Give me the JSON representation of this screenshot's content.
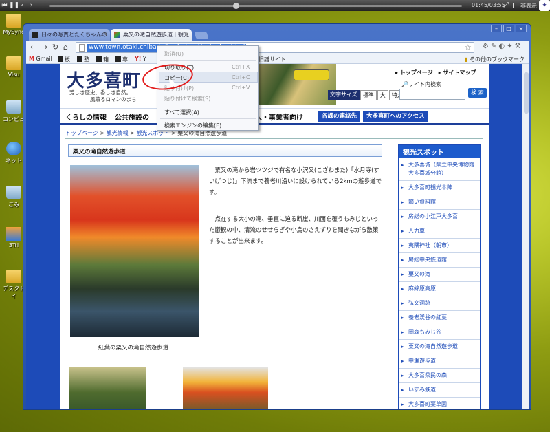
{
  "player": {
    "time": "01:45/03:55",
    "hide_label": "非表示"
  },
  "desktop_icons": [
    {
      "label": "MySync"
    },
    {
      "label": "Visu"
    },
    {
      "label": "コンピュ"
    },
    {
      "label": "ネット"
    },
    {
      "label": "ごみ"
    },
    {
      "label": "3Tri"
    },
    {
      "label": "デスクトイ"
    }
  ],
  "browser": {
    "tabs": [
      {
        "title": "日々の写真とたくちゃんの…"
      },
      {
        "title": "粟又の滝自然遊歩道｜観光…"
      }
    ],
    "url": "www.town.otaki.chiba.jp/kanko/spot/yuhodou.html",
    "bookmarks": [
      "Gmail",
      "板",
      "塾",
      "箱",
      "専",
      "Y",
      "旧譜サイト"
    ],
    "other_bookmarks": "その他のブックマーク"
  },
  "context_menu": {
    "items": [
      {
        "label": "取消(U)",
        "shortcut": "",
        "disabled": true
      },
      {
        "label": "切り取り(T)",
        "shortcut": "Ctrl+X",
        "disabled": false
      },
      {
        "label": "コピー(C)",
        "shortcut": "Ctrl+C",
        "disabled": false
      },
      {
        "label": "貼り付け(P)",
        "shortcut": "Ctrl+V",
        "disabled": true
      },
      {
        "label": "貼り付けて検索(S)",
        "shortcut": "",
        "disabled": true
      },
      {
        "label": "すべて選択(A)",
        "shortcut": "",
        "disabled": false
      },
      {
        "label": "検索エンジンの編集(E)...",
        "shortcut": "",
        "disabled": false
      }
    ]
  },
  "site": {
    "logo": "大多喜町",
    "tagline1": "芳しき歴史、香しき自然。",
    "tagline2": "風薫るロマンのまち",
    "top_links": "▸ トップページ　▸ サイトマップ",
    "search_label": "サイト内検索",
    "search_button": "検 索",
    "font_size": {
      "label": "文字サイズ",
      "standard": "標準",
      "large": "大",
      "xlarge": "特大"
    },
    "global_nav": [
      "くらしの情報",
      "公共施設の",
      "法人・事業者向け"
    ],
    "nav_buttons": [
      "各課の連絡先",
      "大多喜町へのアクセス"
    ],
    "breadcrumb": {
      "top": "トップページ",
      "kanko": "観光情報",
      "spot": "観光スポット",
      "current": "粟又の滝自然遊歩道",
      "sep": " > "
    },
    "heading": "粟又の滝自然遊歩道",
    "para1": "粟又の滝から岩ツツジで有名な小沢又(こざわまた)「水月寺(すいげつじ)」下流まで養老川沿いに設けられている2kmの遊歩道です。",
    "para2": "点在する大小の滝、垂直に迫る断崖、川面を覆うもみじといった巌観の中、清流のせせらぎや小鳥のさえずりを聞きながら散策することが出来ます。",
    "caption": "紅葉の粟又の滝自然遊歩道",
    "sidebar": {
      "title": "観光スポット",
      "items": [
        "大多喜城（県立中央博物館大多喜城分館）",
        "大多喜町観光本陣",
        "節い資料館",
        "房総の小江戸大多喜",
        "人力車",
        "夷隅神社（朝市）",
        "房総中央鉄道館",
        "粟又の滝",
        "麻綿原高原",
        "弘文洞跡",
        "養老渓谷の紅葉",
        "岡森もみじ谷",
        "粟又の滝自然遊歩道",
        "中瀬遊歩道",
        "大多喜県民の森",
        "いすみ鉄道",
        "大多喜町薬草園"
      ]
    }
  }
}
